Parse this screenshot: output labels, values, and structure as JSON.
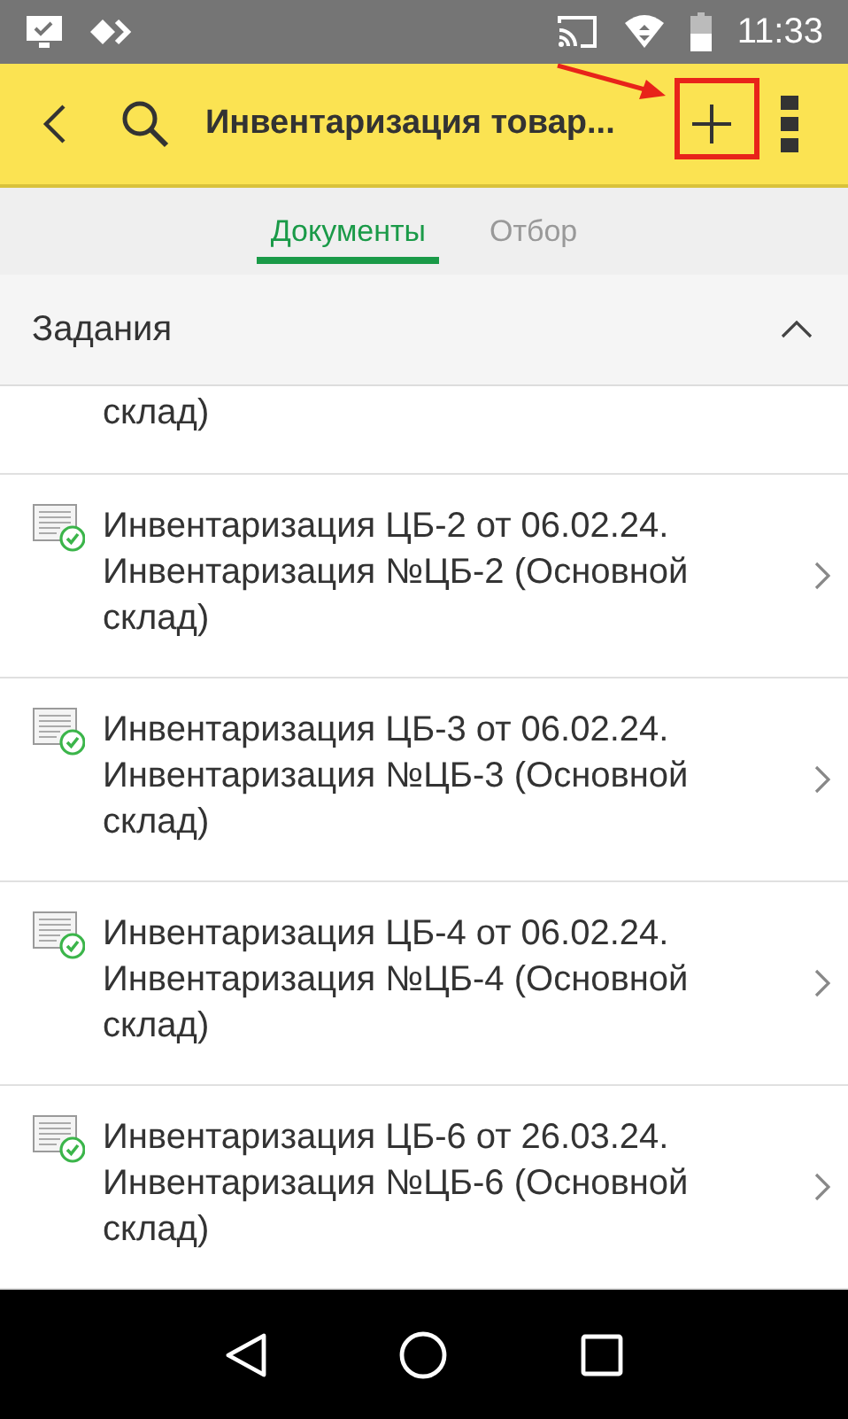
{
  "status_bar": {
    "time": "11:33"
  },
  "toolbar": {
    "title": "Инвентаризация товар..."
  },
  "tabs": [
    {
      "label": "Документы",
      "selected": true
    },
    {
      "label": "Отбор",
      "selected": false
    }
  ],
  "section": {
    "title": "Задания",
    "expanded": true
  },
  "items": [
    {
      "lines": [
        "склад)"
      ],
      "partial": true
    },
    {
      "lines": [
        "Инвентаризация ЦБ-2 от 06.02.24.",
        "Инвентаризация №ЦБ-2 (Основной",
        "склад)"
      ],
      "partial": false
    },
    {
      "lines": [
        "Инвентаризация ЦБ-3 от 06.02.24.",
        "Инвентаризация №ЦБ-3 (Основной",
        "склад)"
      ],
      "partial": false
    },
    {
      "lines": [
        "Инвентаризация ЦБ-4 от 06.02.24.",
        "Инвентаризация №ЦБ-4 (Основной",
        "склад)"
      ],
      "partial": false
    },
    {
      "lines": [
        "Инвентаризация ЦБ-6 от 26.03.24.",
        "Инвентаризация №ЦБ-6 (Основной",
        "склад)"
      ],
      "partial": false
    }
  ]
}
